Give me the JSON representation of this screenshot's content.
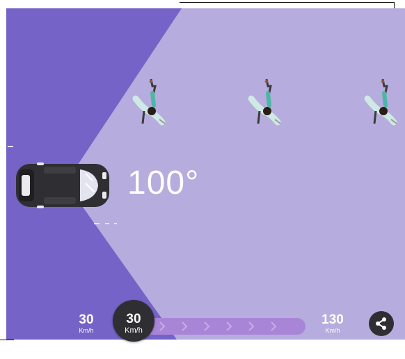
{
  "angle": {
    "value": "100°"
  },
  "speed": {
    "min_value": "30",
    "min_unit": "Km/h",
    "current_value": "30",
    "current_unit": "Km/h",
    "max_value": "130",
    "max_unit": "Km/h",
    "fill_fraction": 0
  },
  "colors": {
    "background_light": "#b6acdd",
    "background_dark": "#7663c8",
    "knob": "#2f2f33",
    "text": "#ffffff"
  },
  "icons": {
    "car": "car-topview-icon",
    "pedestrian": "pedestrian-icon",
    "share": "share-icon"
  }
}
